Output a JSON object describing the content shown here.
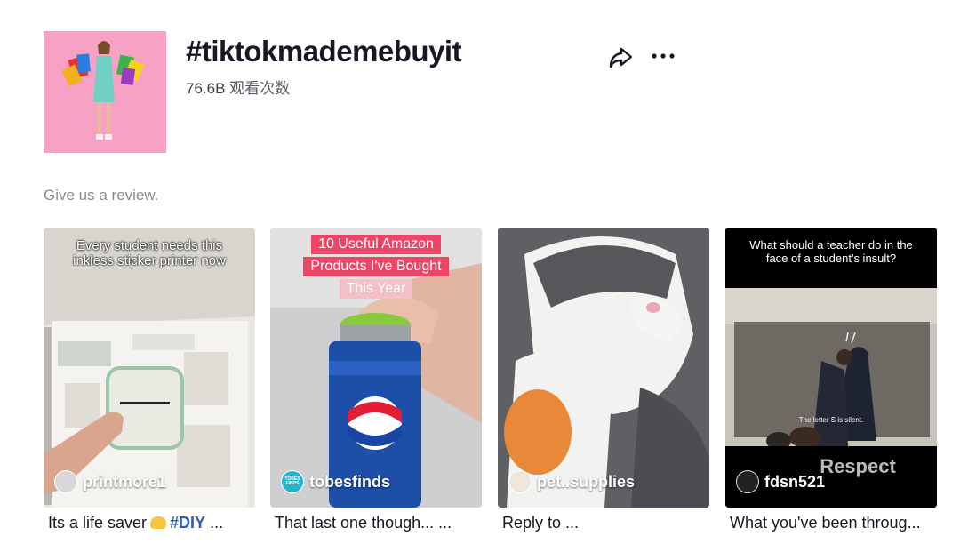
{
  "header": {
    "title": "#tiktokmademebuyit",
    "views_count": "76.6B",
    "views_label": "观看次数"
  },
  "description": "Give us a review.",
  "videos": [
    {
      "overlay_text": "Every student needs this inkless sticker printer now",
      "author": "printmore1",
      "caption": "Its a life saver",
      "caption_tag": "#DIY",
      "caption_suffix": "..."
    },
    {
      "overlay_lines": [
        "10 Useful Amazon",
        "Products I've Bought",
        "This Year"
      ],
      "author": "tobesfinds",
      "avatar_text": "TOBES FINDS",
      "caption": "That last one though... ..."
    },
    {
      "author": "pet..supplies",
      "caption": "Reply to ..."
    },
    {
      "overlay_text": "What should a teacher do in the face of a student's insult?",
      "subtitle": "The letter S is silent.",
      "respect_text": "Respect",
      "author": "fdsn521",
      "caption": "What you've been throug..."
    }
  ],
  "colors": {
    "cover_bg": "#f7a1c4",
    "hashtag_blue": "#2b5db9",
    "muted_text": "#8a8b91"
  }
}
